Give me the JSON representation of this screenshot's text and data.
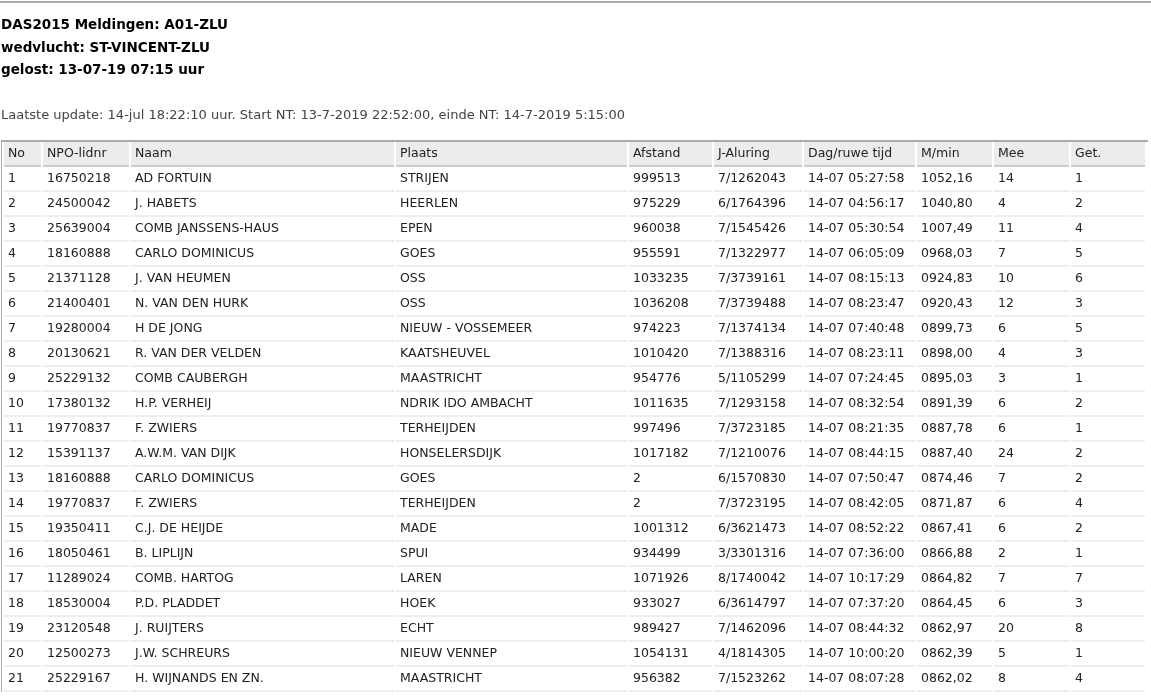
{
  "headings": [
    "DAS2015 Meldingen: A01-ZLU",
    "wedvlucht: ST-VINCENT-ZLU",
    "gelost: 13-07-19 07:15 uur"
  ],
  "update_line": "Laatste update: 14-jul 18:22:10 uur. Start NT: 13-7-2019 22:52:00, einde NT: 14-7-2019 5:15:00",
  "table": {
    "columns": [
      "No",
      "NPO-lidnr",
      "Naam",
      "Plaats",
      "Afstand",
      "J-Aluring",
      "Dag/ruwe tijd",
      "M/min",
      "Mee",
      "Get."
    ],
    "rows": [
      [
        "1",
        "16750218",
        "AD FORTUIN",
        "STRIJEN",
        "999513",
        "7/1262043",
        "14-07 05:27:58",
        "1052,16",
        "14",
        "1"
      ],
      [
        "2",
        "24500042",
        "J. HABETS",
        "HEERLEN",
        "975229",
        "6/1764396",
        "14-07 04:56:17",
        "1040,80",
        "4",
        "2"
      ],
      [
        "3",
        "25639004",
        "COMB JANSSENS-HAUS",
        "EPEN",
        "960038",
        "7/1545426",
        "14-07 05:30:54",
        "1007,49",
        "11",
        "4"
      ],
      [
        "4",
        "18160888",
        "CARLO DOMINICUS",
        "GOES",
        "955591",
        "7/1322977",
        "14-07 06:05:09",
        "0968,03",
        "7",
        "5"
      ],
      [
        "5",
        "21371128",
        "J. VAN HEUMEN",
        "OSS",
        "1033235",
        "7/3739161",
        "14-07 08:15:13",
        "0924,83",
        "10",
        "6"
      ],
      [
        "6",
        "21400401",
        "N. VAN DEN HURK",
        "OSS",
        "1036208",
        "7/3739488",
        "14-07 08:23:47",
        "0920,43",
        "12",
        "3"
      ],
      [
        "7",
        "19280004",
        "H DE JONG",
        "NIEUW - VOSSEMEER",
        "974223",
        "7/1374134",
        "14-07 07:40:48",
        "0899,73",
        "6",
        "5"
      ],
      [
        "8",
        "20130621",
        "R. VAN DER VELDEN",
        "KAATSHEUVEL",
        "1010420",
        "7/1388316",
        "14-07 08:23:11",
        "0898,00",
        "4",
        "3"
      ],
      [
        "9",
        "25229132",
        "COMB CAUBERGH",
        "MAASTRICHT",
        "954776",
        "5/1105299",
        "14-07 07:24:45",
        "0895,03",
        "3",
        "1"
      ],
      [
        "10",
        "17380132",
        "H.P. VERHEIJ",
        "NDRIK IDO AMBACHT",
        "1011635",
        "7/1293158",
        "14-07 08:32:54",
        "0891,39",
        "6",
        "2"
      ],
      [
        "11",
        "19770837",
        "F. ZWIERS",
        "TERHEIJDEN",
        "997496",
        "7/3723185",
        "14-07 08:21:35",
        "0887,78",
        "6",
        "1"
      ],
      [
        "12",
        "15391137",
        "A.W.M. VAN DIJK",
        "HONSELERSDIJK",
        "1017182",
        "7/1210076",
        "14-07 08:44:15",
        "0887,40",
        "24",
        "2"
      ],
      [
        "13",
        "18160888",
        "CARLO DOMINICUS",
        "GOES",
        "2",
        "6/1570830",
        "14-07 07:50:47",
        "0874,46",
        "7",
        "2"
      ],
      [
        "14",
        "19770837",
        "F. ZWIERS",
        "TERHEIJDEN",
        "2",
        "7/3723195",
        "14-07 08:42:05",
        "0871,87",
        "6",
        "4"
      ],
      [
        "15",
        "19350411",
        "C.J. DE HEIJDE",
        "MADE",
        "1001312",
        "6/3621473",
        "14-07 08:52:22",
        "0867,41",
        "6",
        "2"
      ],
      [
        "16",
        "18050461",
        "B. LIPLIJN",
        "SPUI",
        "934499",
        "3/3301316",
        "14-07 07:36:00",
        "0866,88",
        "2",
        "1"
      ],
      [
        "17",
        "11289024",
        "COMB. HARTOG",
        "LAREN",
        "1071926",
        "8/1740042",
        "14-07 10:17:29",
        "0864,82",
        "7",
        "7"
      ],
      [
        "18",
        "18530004",
        "P.D. PLADDET",
        "HOEK",
        "933027",
        "6/3614797",
        "14-07 07:37:20",
        "0864,45",
        "6",
        "3"
      ],
      [
        "19",
        "23120548",
        "J. RUIJTERS",
        "ECHT",
        "989427",
        "7/1462096",
        "14-07 08:44:32",
        "0862,97",
        "20",
        "8"
      ],
      [
        "20",
        "12500273",
        "J.W. SCHREURS",
        "NIEUW VENNEP",
        "1054131",
        "4/1814305",
        "14-07 10:00:20",
        "0862,39",
        "5",
        "1"
      ],
      [
        "21",
        "25229167",
        "H. WIJNANDS EN ZN.",
        "MAASTRICHT",
        "956382",
        "7/1523262",
        "14-07 08:07:28",
        "0862,02",
        "8",
        "4"
      ]
    ]
  }
}
